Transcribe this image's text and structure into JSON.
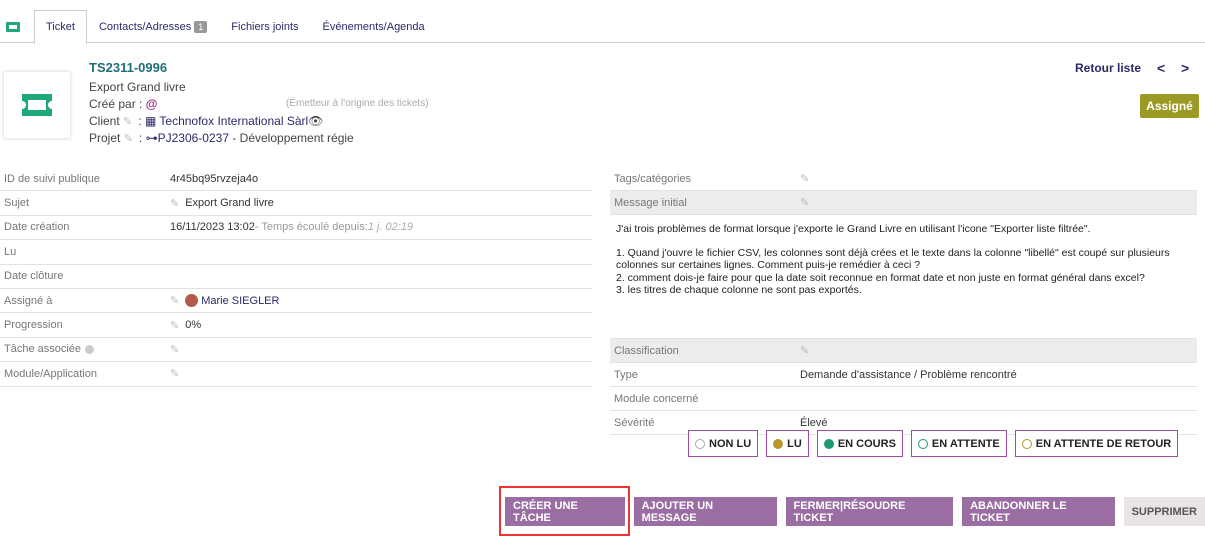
{
  "tabs": [
    {
      "label": "Ticket"
    },
    {
      "label": "Contacts/Adresses",
      "badge": "1"
    },
    {
      "label": "Fichiers joints"
    },
    {
      "label": "Événements/Agenda"
    }
  ],
  "header": {
    "ref": "TS2311-0996",
    "title": "Export Grand livre",
    "cree_par_label": "Créé par :",
    "cree_par_value": "@",
    "emetteur_note": "(Émetteur à l'origine des tickets)",
    "client_label": "Client",
    "client_value": "Technofox International Sàrl",
    "projet_label": "Projet",
    "projet_value": "PJ2306-0237",
    "projet_desc": " - Développement régie",
    "retour": "Retour liste",
    "prev": "<",
    "next": ">",
    "status": "Assigné"
  },
  "left_fields": {
    "suivi_label": "ID de suivi publique",
    "suivi_value": "4r45bq95rvzeja4o",
    "sujet_label": "Sujet",
    "sujet_value": "Export Grand livre",
    "creation_label": "Date création",
    "creation_value": "16/11/2023 13:02",
    "creation_elapsed_label": " - Temps écoulé depuis: ",
    "creation_elapsed": "1 j. 02:19",
    "lu_label": "Lu",
    "cloture_label": "Date clôture",
    "assigne_label": "Assigné à",
    "assigne_value": "Marie SIEGLER",
    "progression_label": "Progression",
    "progression_value": "0%",
    "tache_label": "Tâche associée",
    "module_label": "Module/Application"
  },
  "right_fields": {
    "tags_label": "Tags/catégories",
    "message_label": "Message initial",
    "message_lines": [
      "J'ai trois problèmes de format lorsque j'exporte le Grand Livre en utilisant l'icone \"Exporter liste filtrée\".",
      "1. Quand j'ouvre le fichier CSV, les colonnes sont déjà crées et le texte dans la colonne \"libellé\" est coupé sur plusieurs colonnes sur certaines lignes. Comment puis-je remédier à ceci ?",
      "2. comment dois-je faire pour que la date soit reconnue en format date et non juste en format général dans excel?",
      "3. les titres de chaque colonne ne sont pas exportés."
    ],
    "classification_label": "Classification",
    "type_label": "Type",
    "type_value": "Demande d'assistance / Problème rencontré",
    "module_label": "Module concerné",
    "severite_label": "Sévérité",
    "severite_value": "Élevé"
  },
  "status_buttons": [
    {
      "label": "NON LU",
      "color": "#ffffff"
    },
    {
      "label": "LU",
      "color": "#b8962e"
    },
    {
      "label": "EN COURS",
      "color": "#1f9a6e"
    },
    {
      "label": "EN ATTENTE",
      "color": "#ffffff"
    },
    {
      "label": "EN ATTENTE DE RETOUR",
      "color": "#ffffff"
    }
  ],
  "actions": {
    "creer_tache": "CRÉER UNE TÂCHE",
    "ajouter_message": "AJOUTER UN MESSAGE",
    "fermer": "FERMER|RÉSOUDRE TICKET",
    "abandonner": "ABANDONNER LE TICKET",
    "supprimer": "SUPPRIMER"
  },
  "colors": {
    "accent": "#9a6da3",
    "teal": "#1e6e78",
    "status": "#9b9a24",
    "highlight": "#e33333"
  }
}
